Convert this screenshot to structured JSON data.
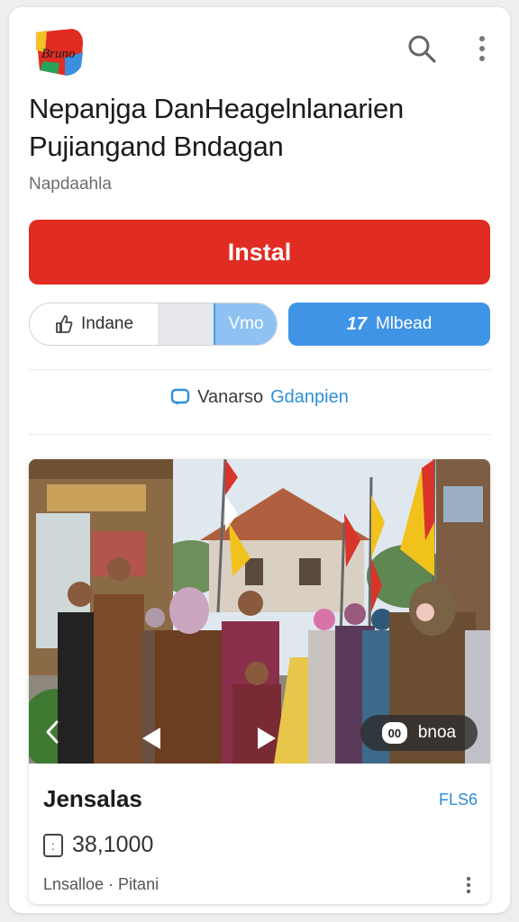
{
  "header": {
    "logo_text": "Bruno",
    "search_icon": "search-icon",
    "menu_icon": "more-vertical-icon"
  },
  "app": {
    "title": "Nepanjga DanHeagelnlanarien Pujiangand Bndagan",
    "developer": "Napdaahla"
  },
  "actions": {
    "install_label": "Instal",
    "segment_left_label": "Indane",
    "segment_right_label": "Vmo",
    "blue_button_label": "Mlbead",
    "blue_button_icon_text": "17"
  },
  "link": {
    "part1": "Vanarso",
    "part2": "Gdanpien"
  },
  "media": {
    "badge_text": "bnoa",
    "badge_icon_text": "00"
  },
  "item": {
    "name": "Jensalas",
    "tag": "FLS6",
    "price": "38,1000",
    "meta": "Lnsalloe · Pitani"
  },
  "colors": {
    "install": "#e02c22",
    "accent_blue": "#3f94e6",
    "link_blue": "#2e8fd8"
  }
}
